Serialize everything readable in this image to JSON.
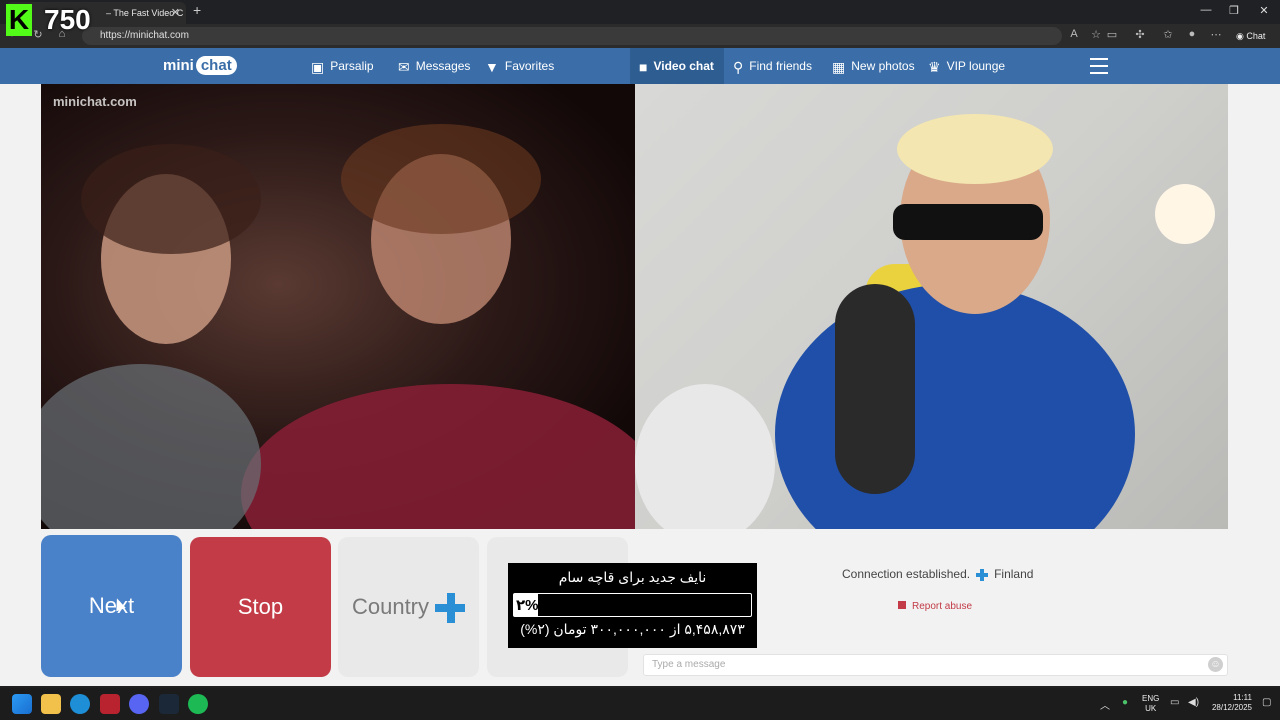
{
  "browser": {
    "tab_title": "– The Fast Video C",
    "tab_close": "✕",
    "new_tab": "+",
    "url": "https://minichat.com",
    "chat_label": "Chat",
    "win_min": "—",
    "win_restore": "❐",
    "win_close": "✕"
  },
  "overlay": {
    "badge": "K",
    "count": "750"
  },
  "site": {
    "logo_left": "mini",
    "logo_right": "chat",
    "nav": [
      {
        "label": "Parsalip",
        "icon": "portrait-icon"
      },
      {
        "label": "Messages",
        "icon": "envelope-icon"
      },
      {
        "label": "Favorites",
        "icon": "bookmark-icon"
      },
      {
        "label": "Video chat",
        "icon": "video-camera-icon"
      },
      {
        "label": "Find friends",
        "icon": "search-icon"
      },
      {
        "label": "New photos",
        "icon": "grid-icon"
      },
      {
        "label": "VIP lounge",
        "icon": "crown-icon"
      }
    ],
    "watermark": "minichat.com"
  },
  "controls": {
    "next": "Next",
    "stop": "Stop",
    "country": "Country"
  },
  "donation": {
    "title": "نایف جدید برای قاچه سام",
    "percent_label": "۲%",
    "progress": 0.02,
    "amount": "۵,۴۵۸,۸۷۳ از ۳۰۰,۰۰۰,۰۰۰ تومان (۲%)"
  },
  "status": {
    "connection": "Connection established.",
    "country": "Finland",
    "report": "Report abuse",
    "message_placeholder": "Type a message"
  },
  "taskbar": {
    "lang_top": "ENG",
    "lang_bottom": "UK",
    "time": "11:11",
    "date": "28/12/2025"
  },
  "colors": {
    "nav_blue": "#3b6ea8",
    "next_blue": "#4a82c9",
    "stop_red": "#c23b46",
    "finland_blue": "#2b8fd6"
  }
}
